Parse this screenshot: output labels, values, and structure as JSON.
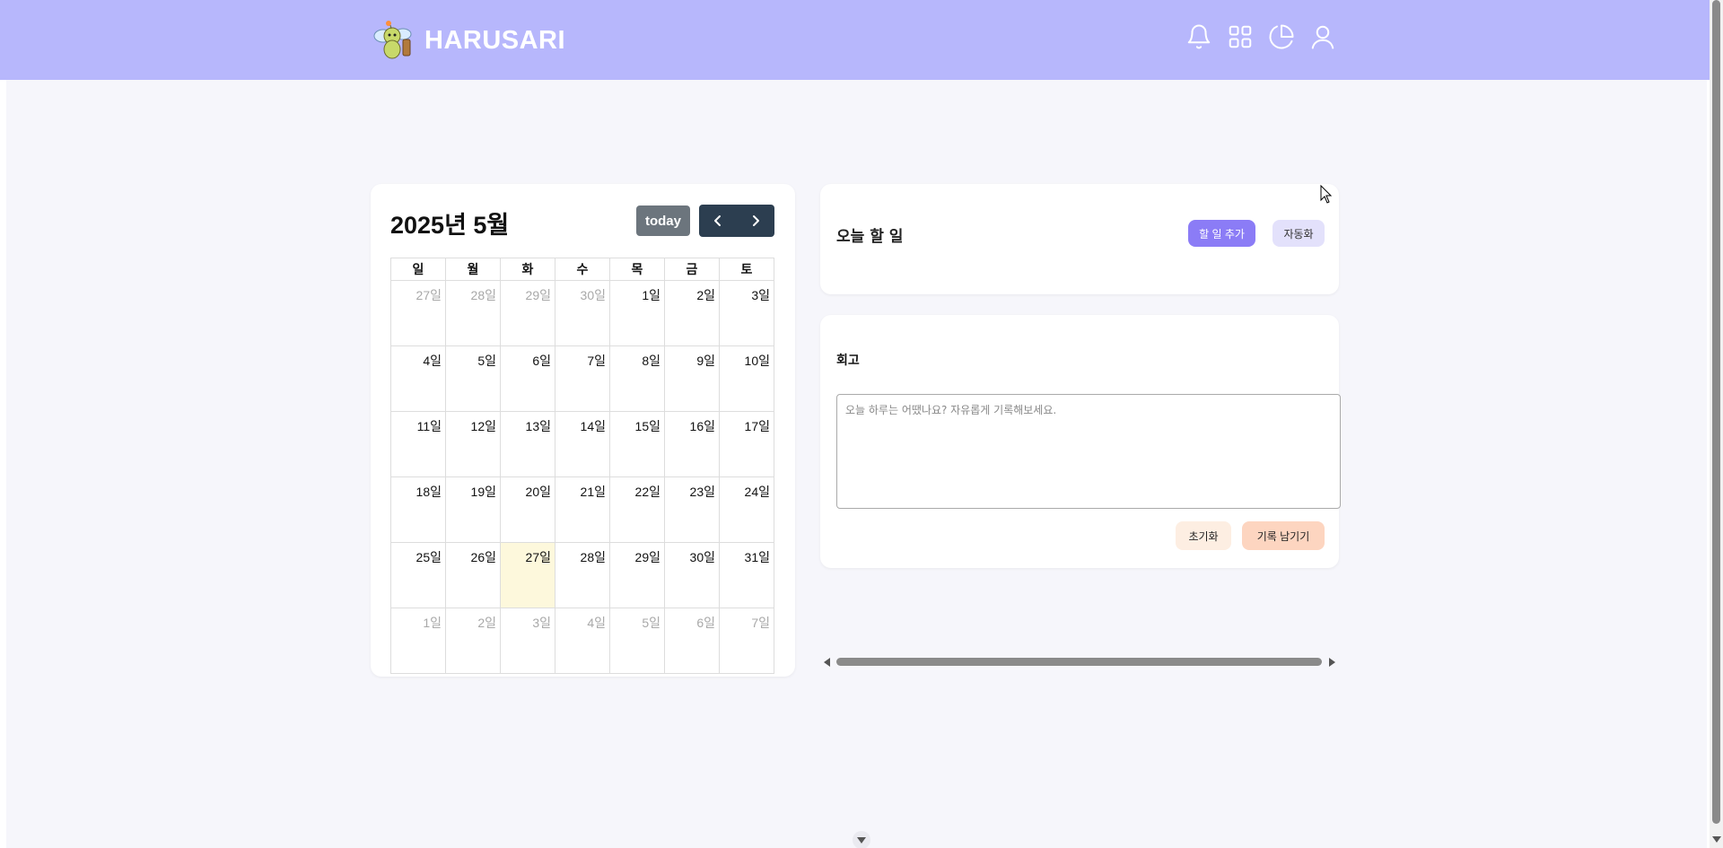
{
  "header": {
    "brand": "HARUSARI",
    "icons": [
      "bell-icon",
      "grid-icon",
      "pie-chart-icon",
      "user-icon"
    ],
    "background": "#b7b7fc"
  },
  "calendar": {
    "title": "2025년 5월",
    "today_label": "today",
    "weekdays": [
      "일",
      "월",
      "화",
      "수",
      "목",
      "금",
      "토"
    ],
    "weeks": [
      [
        "27일",
        "28일",
        "29일",
        "30일",
        "1일",
        "2일",
        "3일"
      ],
      [
        "4일",
        "5일",
        "6일",
        "7일",
        "8일",
        "9일",
        "10일"
      ],
      [
        "11일",
        "12일",
        "13일",
        "14일",
        "15일",
        "16일",
        "17일"
      ],
      [
        "18일",
        "19일",
        "20일",
        "21일",
        "22일",
        "23일",
        "24일"
      ],
      [
        "25일",
        "26일",
        "27일",
        "28일",
        "29일",
        "30일",
        "31일"
      ],
      [
        "1일",
        "2일",
        "3일",
        "4일",
        "5일",
        "6일",
        "7일"
      ]
    ],
    "highlight_color": "#fdf8dc"
  },
  "todo": {
    "title": "오늘 할 일",
    "add_label": "할 일 추가",
    "auto_label": "자동화"
  },
  "retro": {
    "title": "회고",
    "placeholder": "오늘 하루는 어땠나요? 자유롭게 기록해보세요.",
    "value": "",
    "reset_label": "초기화",
    "save_label": "기록 남기기"
  },
  "colors": {
    "primary_button": "#8b7cf6",
    "nav_dark": "#2c3e50",
    "today_button": "#6c757d"
  }
}
